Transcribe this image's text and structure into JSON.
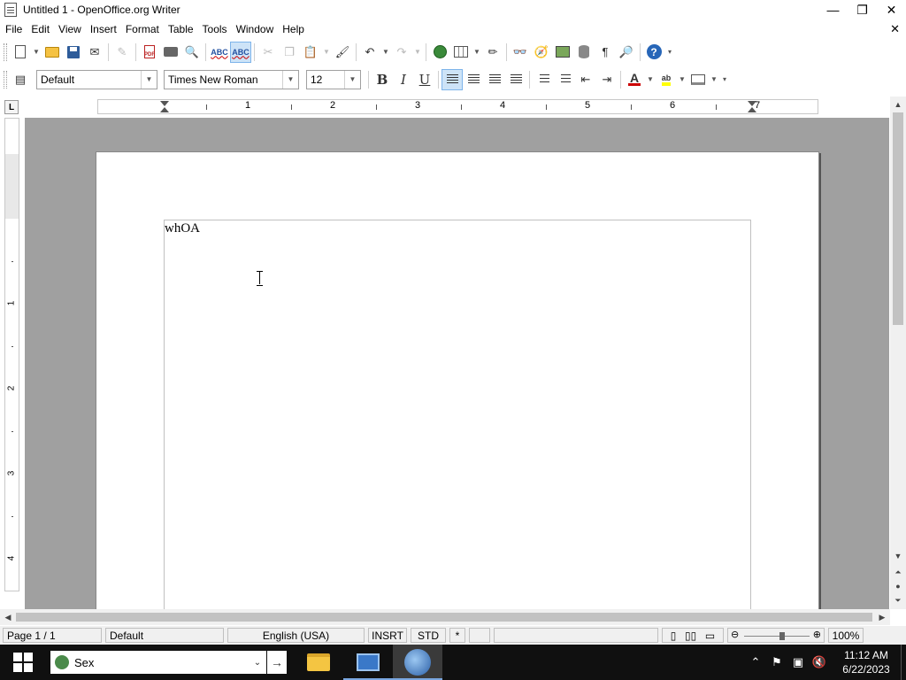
{
  "window": {
    "title": "Untitled 1 - OpenOffice.org Writer",
    "controls": {
      "minimize": "—",
      "restore": "❐",
      "close": "✕"
    }
  },
  "menubar": {
    "items": [
      "File",
      "Edit",
      "View",
      "Insert",
      "Format",
      "Table",
      "Tools",
      "Window",
      "Help"
    ],
    "doc_close": "✕"
  },
  "formatting": {
    "paragraph_style": "Default",
    "font_name": "Times New Roman",
    "font_size": "12",
    "bold_label": "B",
    "italic_label": "I",
    "underline_label": "U",
    "alignment": "left"
  },
  "ruler": {
    "h_numbers": [
      "1",
      "2",
      "3",
      "4",
      "5",
      "6",
      "7"
    ],
    "v_numbers": [
      "1",
      "2",
      "3",
      "4"
    ],
    "tab_type": "L"
  },
  "document": {
    "text": "whOA"
  },
  "statusbar": {
    "page": "Page 1 / 1",
    "style": "Default",
    "language": "English (USA)",
    "insert_mode": "INSRT",
    "selection_mode": "STD",
    "modified": "*",
    "zoom": "100%"
  },
  "taskbar": {
    "search_text": "Sex",
    "clock_time": "11:12 AM",
    "clock_date": "6/22/2023"
  },
  "colors": {
    "accent": "#7eb4ea",
    "taskbar": "#101010",
    "doc_background": "#a0a0a0"
  }
}
